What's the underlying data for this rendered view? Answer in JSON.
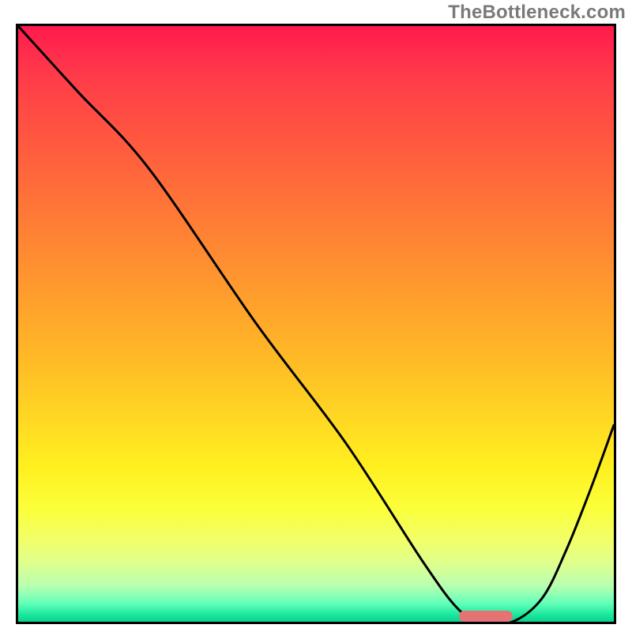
{
  "watermark": "TheBottleneck.com",
  "chart_data": {
    "type": "line",
    "title": "",
    "xlabel": "",
    "ylabel": "",
    "xlim": [
      0,
      100
    ],
    "ylim": [
      0,
      100
    ],
    "grid": false,
    "legend": false,
    "background": "red-yellow-green vertical gradient (bottleneck heatmap)",
    "series": [
      {
        "name": "bottleneck-curve",
        "x": [
          0,
          10,
          22,
          40,
          55,
          68,
          74,
          78,
          83,
          88,
          92,
          96,
          100
        ],
        "y": [
          100,
          89,
          76,
          50,
          30,
          10,
          2,
          0,
          0,
          4,
          12,
          22,
          33
        ]
      }
    ],
    "optimal_range": {
      "x_start": 74,
      "x_end": 83,
      "y": 0
    },
    "colors": {
      "curve": "#000000",
      "marker": "#e57373",
      "gradient_top": "#ff1a4d",
      "gradient_mid": "#ffd823",
      "gradient_bottom": "#0fd18f"
    }
  }
}
